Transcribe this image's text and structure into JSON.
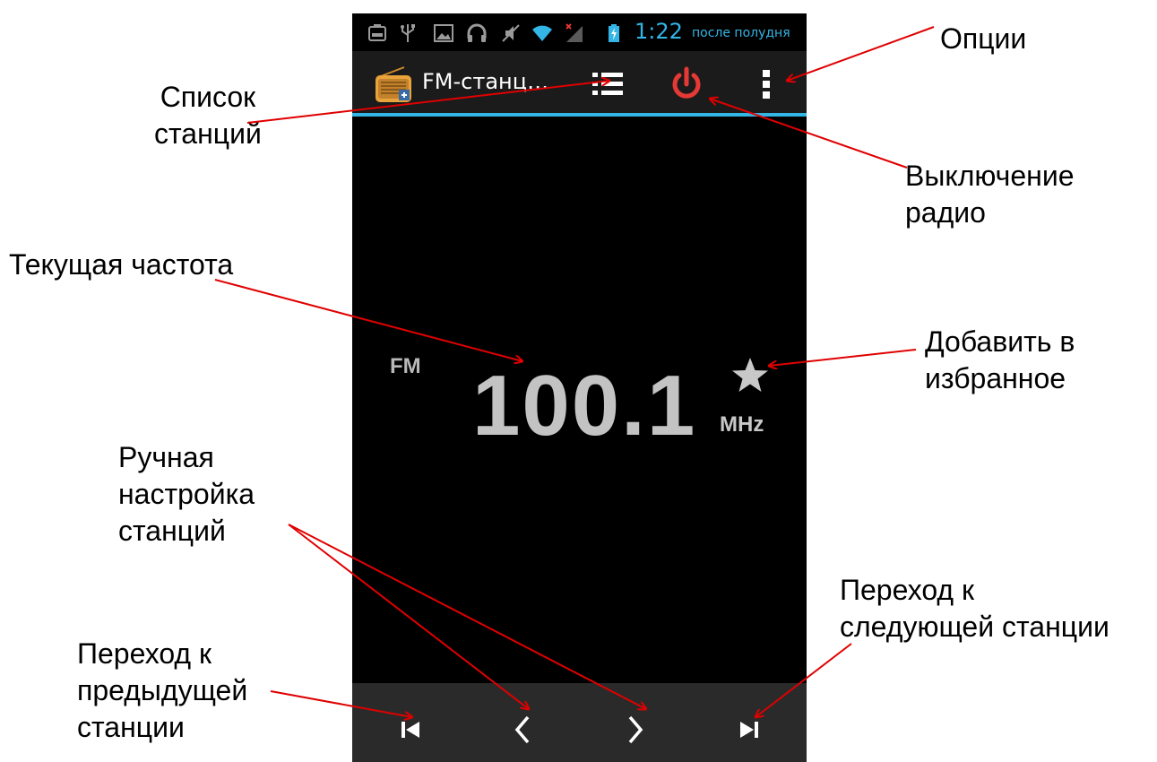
{
  "status_bar": {
    "time": "1:22",
    "time_suffix": "после полудня",
    "icons": [
      "sim-card-icon",
      "usb-icon",
      "image-icon",
      "headphones-icon",
      "mute-icon",
      "wifi-icon",
      "no-signal-icon",
      "battery-charging-icon"
    ],
    "accent_color": "#33b5e5"
  },
  "action_bar": {
    "app_icon": "radio-icon",
    "title": "FM-станц…",
    "buttons": [
      "station-list-icon",
      "power-icon",
      "overflow-menu-icon"
    ],
    "power_color": "#e53935"
  },
  "tuner": {
    "band": "FM",
    "frequency": "100.1",
    "unit": "MHz",
    "favorite_icon": "star-icon"
  },
  "controls": [
    "skip-previous-icon",
    "chevron-left-icon",
    "chevron-right-icon",
    "skip-next-icon"
  ],
  "annotations": {
    "options": "Опции",
    "station_list": [
      "Список",
      "станций"
    ],
    "power_off": [
      "Выключение",
      "радио"
    ],
    "current_frequency": "Текущая частота",
    "add_favorite": [
      "Добавить в",
      "избранное"
    ],
    "manual_tuning": [
      "Ручная",
      "настройка",
      "станций"
    ],
    "next_station": [
      "Переход к",
      "следующей станции"
    ],
    "prev_station": [
      "Переход к",
      "предыдущей",
      "станции"
    ]
  },
  "arrow_color": "#e00000"
}
